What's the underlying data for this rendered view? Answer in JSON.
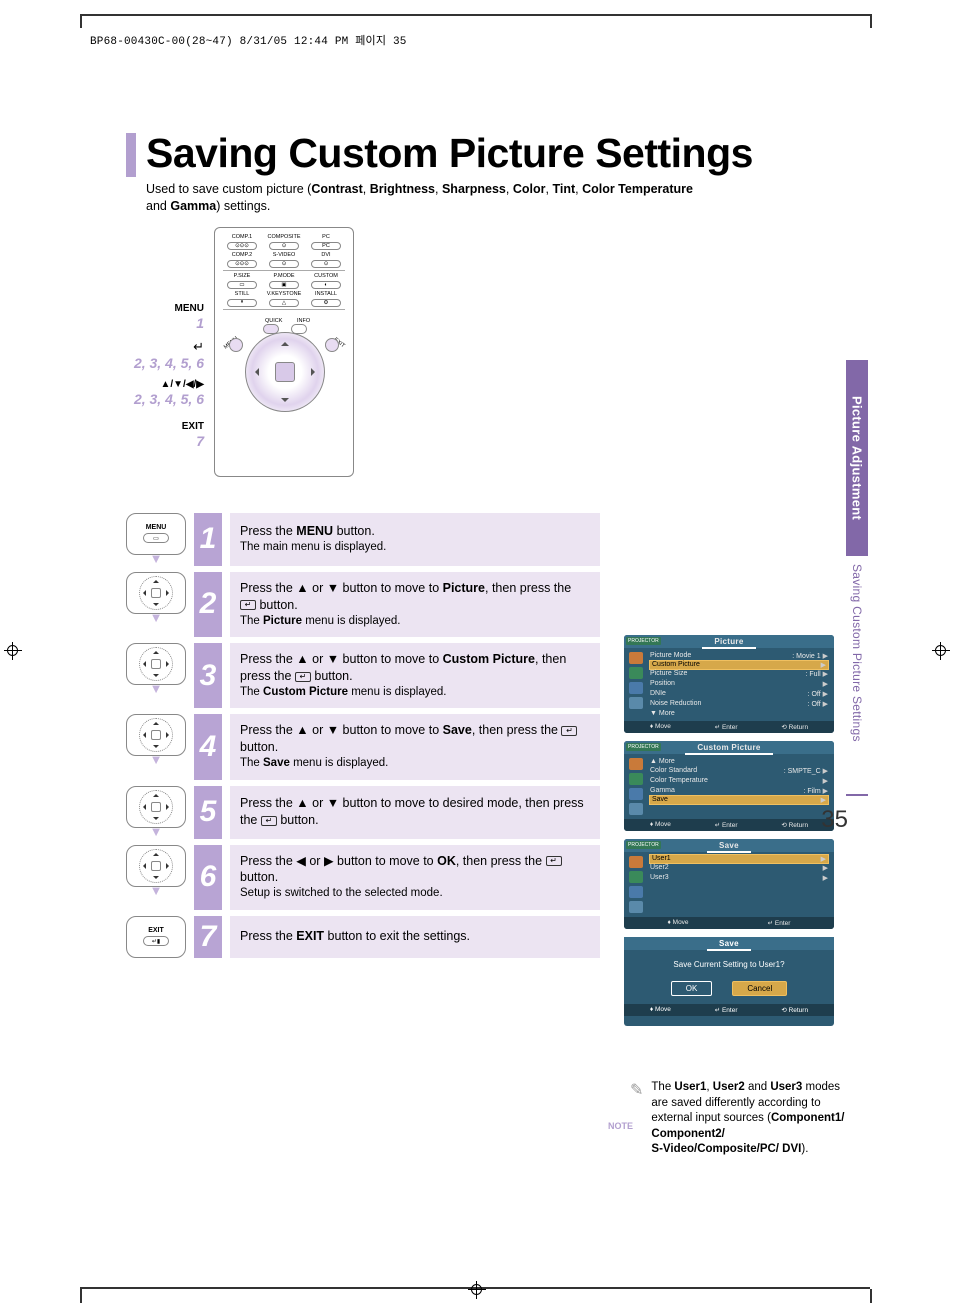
{
  "header": "BP68-00430C-00(28~47)  8/31/05  12:44 PM  페이지 35",
  "title": "Saving Custom Picture Settings",
  "intro_pre": "Used to save custom picture (",
  "intro_bold": [
    "Contrast",
    "Brightness",
    "Sharpness",
    "Color",
    "Tint",
    "Color Temperature",
    "Gamma"
  ],
  "intro_and": "and ",
  "intro_post": ") settings.",
  "remote_labels": {
    "menu": "MENU",
    "menu_n": "1",
    "enter": "↵",
    "enter_n": "2, 3, 4, 5, 6",
    "dpad": "▲/▼/◀/▶",
    "dpad_n": "2, 3, 4, 5, 6",
    "exit": "EXIT",
    "exit_n": "7"
  },
  "remote_top_rows": [
    [
      "COMP.1",
      "COMPOSITE",
      "PC"
    ],
    [
      "COMP.2",
      "S-VIDEO",
      "DVI"
    ]
  ],
  "remote_mid_rows": [
    [
      "P.SIZE",
      "P.MODE",
      "CUSTOM"
    ],
    [
      "STILL",
      "V.KEYSTONE",
      "INSTALL"
    ]
  ],
  "remote_nav": {
    "quick": "QUICK",
    "info": "INFO",
    "menu": "MENU",
    "exit": "EXIT"
  },
  "sidebar": {
    "top": "Picture Adjustment",
    "bottom": "Saving Custom Picture Settings"
  },
  "steps": [
    {
      "n": "1",
      "icon": "MENU",
      "line1_a": "Press the ",
      "line1_b": "MENU",
      "line1_c": " button.",
      "sub": "The main menu is displayed."
    },
    {
      "n": "2",
      "icon": "nav",
      "line1_a": "Press the ▲ or ▼ button to move to ",
      "line1_b": "Picture",
      "line1_c": ", then press the ",
      "line1_d": " button.",
      "sub_a": "The ",
      "sub_b": "Picture",
      "sub_c": " menu is displayed."
    },
    {
      "n": "3",
      "icon": "nav",
      "line1_a": "Press the ▲ or ▼ button to move to ",
      "line1_b": "Custom Picture",
      "line1_c": ", then press the ",
      "line1_d": " button.",
      "sub_a": "The ",
      "sub_b": "Custom Picture",
      "sub_c": " menu is displayed."
    },
    {
      "n": "4",
      "icon": "nav",
      "line1_a": "Press the ▲ or ▼ button to move to ",
      "line1_b": "Save",
      "line1_c": ", then press the ",
      "line1_d": " button.",
      "sub_a": "The ",
      "sub_b": "Save",
      "sub_c": " menu is displayed."
    },
    {
      "n": "5",
      "icon": "nav",
      "line1_a": "Press the ▲ or ▼ button to move to desired mode, then press the ",
      "line1_d": " button."
    },
    {
      "n": "6",
      "icon": "nav",
      "line1_a": "Press the ◀ or ▶ button to move to ",
      "line1_b": "OK",
      "line1_c": ", then press the ",
      "line1_d": " button.",
      "sub": "Setup is switched to the selected mode."
    },
    {
      "n": "7",
      "icon": "EXIT",
      "line1_a": "Press the ",
      "line1_b": "EXIT",
      "line1_c": " button to exit the settings."
    }
  ],
  "osd": {
    "projector": "PROJECTOR",
    "ftr": {
      "move": "Move",
      "enter": "Enter",
      "return": "Return"
    },
    "menu1": {
      "title": "Picture",
      "rows": [
        [
          "Picture Mode",
          ": Movie 1",
          "▶"
        ],
        [
          "Custom Picture",
          "",
          "▶"
        ],
        [
          "Picture Size",
          ": Full",
          "▶"
        ],
        [
          "Position",
          "",
          "▶"
        ],
        [
          "DNIe",
          ": Off",
          "▶"
        ],
        [
          "Noise Reduction",
          ": Off",
          "▶"
        ],
        [
          "▼ More",
          "",
          ""
        ]
      ],
      "sel": 1
    },
    "menu2": {
      "title": "Custom Picture",
      "rows": [
        [
          "▲ More",
          "",
          ""
        ],
        [
          "Color Standard",
          ": SMPTE_C",
          "▶"
        ],
        [
          "Color Temperature",
          "",
          "▶"
        ],
        [
          "Gamma",
          ": Film",
          "▶"
        ],
        [
          "Save",
          "",
          "▶"
        ]
      ],
      "sel": 4
    },
    "menu3": {
      "title": "Save",
      "rows": [
        [
          "User1",
          "",
          "▶"
        ],
        [
          "User2",
          "",
          "▶"
        ],
        [
          "User3",
          "",
          "▶"
        ]
      ],
      "sel": 0
    },
    "dialog": {
      "title": "Save",
      "msg": "Save Current Setting to User1?",
      "ok": "OK",
      "cancel": "Cancel"
    }
  },
  "note": {
    "label": "NOTE",
    "pre": "The ",
    "u1": "User1",
    "c1": ", ",
    "u2": "User2",
    "c2": " and ",
    "u3": "User3",
    "body": " modes are saved differently according to external input sources (",
    "src": "Component1/ Component2/\nS-Video/Composite/PC/ DVI",
    "end": ")."
  },
  "page_number": "35"
}
